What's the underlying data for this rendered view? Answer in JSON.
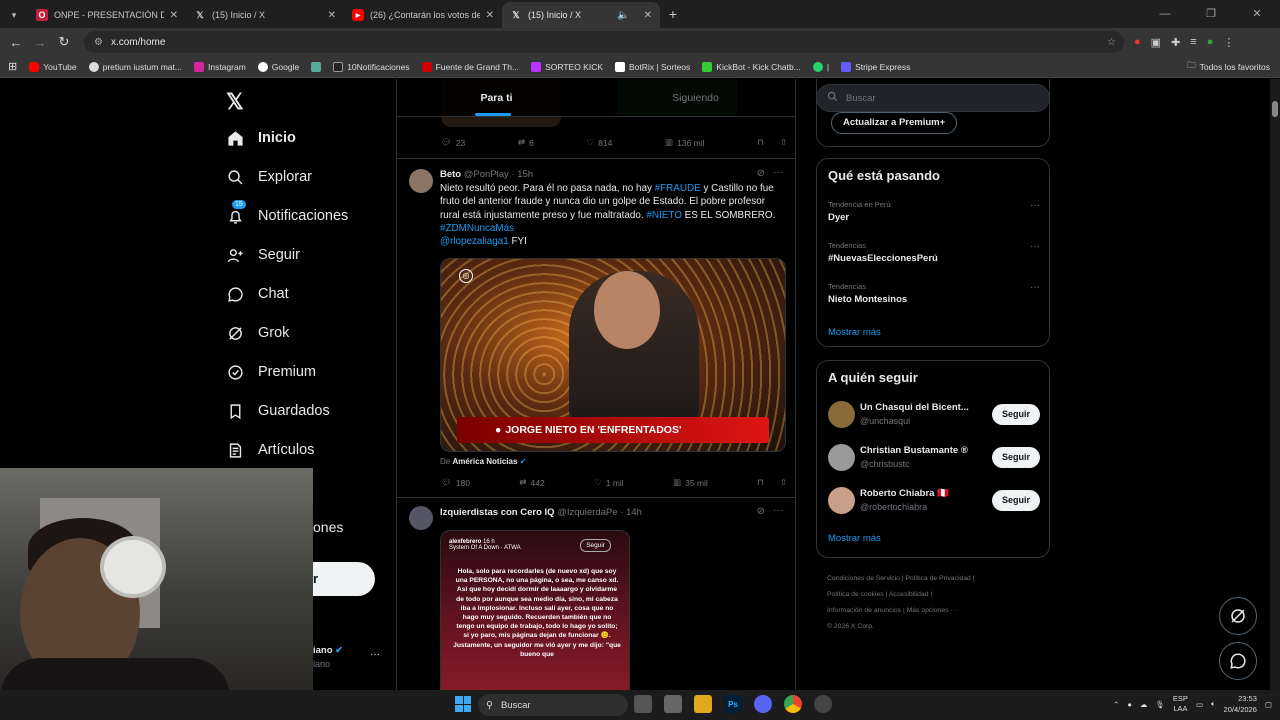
{
  "browser": {
    "tabs": [
      {
        "title": "ONPE - PRESENTACIÓN DE RES",
        "fav": "O",
        "color": "#c41e3a",
        "active": false
      },
      {
        "title": "(15) Inicio / X",
        "fav": "X",
        "color": "#ffffff",
        "active": false
      },
      {
        "title": "(26) ¿Contarán los votos de ac",
        "fav": "▶",
        "color": "#ff0000",
        "active": false
      },
      {
        "title": "(15) Inicio / X",
        "fav": "X",
        "color": "#ffffff",
        "active": true
      }
    ],
    "url": "x.com/home",
    "bookmarks": [
      "YouTube",
      "pretium iustum mat...",
      "Instagram",
      "Google",
      "",
      "10Notificaciones",
      "Fuente de Grand Th...",
      "SORTEO KICK",
      "BotRix | Sorteos",
      "KickBot - Kick Chatb...",
      "|",
      "Stripe Express"
    ],
    "bookmarks_right": "Todos los favoritos"
  },
  "nav": {
    "items": [
      "Inicio",
      "Explorar",
      "Notificaciones",
      "Seguir",
      "Chat",
      "Grok",
      "Premium",
      "Guardados",
      "Artículos"
    ],
    "badge": "15",
    "hidden_item": "ones",
    "post_button": "r",
    "profile_name": "iano",
    "profile_handle": "lano"
  },
  "timeline": {
    "tab_for_you": "Para ti",
    "tab_following": "Siguiendo",
    "top_actions": {
      "replies": "23",
      "reposts": "6",
      "likes": "814",
      "views": "136 mil"
    },
    "post1": {
      "name": "Beto",
      "handle": "@PonPlay",
      "time": "· 15h",
      "text1": "Nieto resultó peor. Para él no pasa nada, no hay ",
      "tag1": "#FRAUDE",
      "text2": " y Castillo no fue fruto del anterior fraude y nunca dio un golpe de Estado. El pobre profesor rural está injustamente preso y fue maltratado. ",
      "tag2": "#NIETO",
      "text3": " ES EL SOMBRERO.",
      "tag3": "#ZDMNuncaMás",
      "mention": "@rlopezaliaga1",
      "text4": " FYI",
      "media_banner": "JORGE NIETO EN 'ENFRENTADOS'",
      "source_prefix": "De",
      "source_name": "América Noticias",
      "actions": {
        "replies": "180",
        "reposts": "442",
        "likes": "1 mil",
        "views": "35 mil"
      }
    },
    "post2": {
      "name": "Izquierdistas con Cero IQ",
      "handle": "@IzquierdaPe",
      "time": "· 14h",
      "story_user": "alexfebrero",
      "story_time": "16 h",
      "story_music": "System Of A Down · ATWA",
      "story_follow": "Seguir",
      "story_text": "Hola, solo para recordarles (de nuevo xd) que soy una PERSONA, no una página, o sea, me canso xd. Así que hoy decidí dormir de laaaargo y olvidarme de todo por aunque sea medio día, sino, mi cabeza iba a implosionar. Incluso salí ayer, cosa que no hago muy seguido. Recuerden también que no tengo un equipo de trabajo, todo lo hago yo solito; si yo paro, mis páginas dejan de funcionar 😊. Justamente, un seguidor me vió ayer y me dijo: \"que bueno que"
    }
  },
  "sidebar": {
    "search_placeholder": "Buscar",
    "premium_button": "Actualizar a Premium+",
    "trends_title": "Qué está pasando",
    "trends": [
      {
        "meta": "Tendencia en Perú",
        "name": "Dyer"
      },
      {
        "meta": "Tendencias",
        "name": "#NuevasEleccionesPerú"
      },
      {
        "meta": "Tendencias",
        "name": "Nieto Montesinos"
      }
    ],
    "show_more": "Mostrar más",
    "who_title": "A quién seguir",
    "who": [
      {
        "name": "Un Chasqui del Bicent...",
        "handle": "@unchasqui",
        "color": "#8a6a3a"
      },
      {
        "name": "Christian Bustamante ®",
        "handle": "@chrisbustc",
        "color": "#9a9a9a"
      },
      {
        "name": "Roberto Chiabra 🇵🇪",
        "handle": "@robertochiabra",
        "color": "#c8a08a"
      }
    ],
    "follow_label": "Seguir",
    "show_more_2": "Mostrar más",
    "footer": [
      "Condiciones de Servicio",
      "Política de Privacidad",
      "Política de cookies",
      "Accesibilidad",
      "Información de anuncios",
      "Más opciones ···",
      "© 2026 X Corp."
    ]
  },
  "taskbar": {
    "search": "Buscar",
    "lang1": "ESP",
    "lang2": "LAA",
    "time": "23:53",
    "date": "20/4/2026"
  }
}
